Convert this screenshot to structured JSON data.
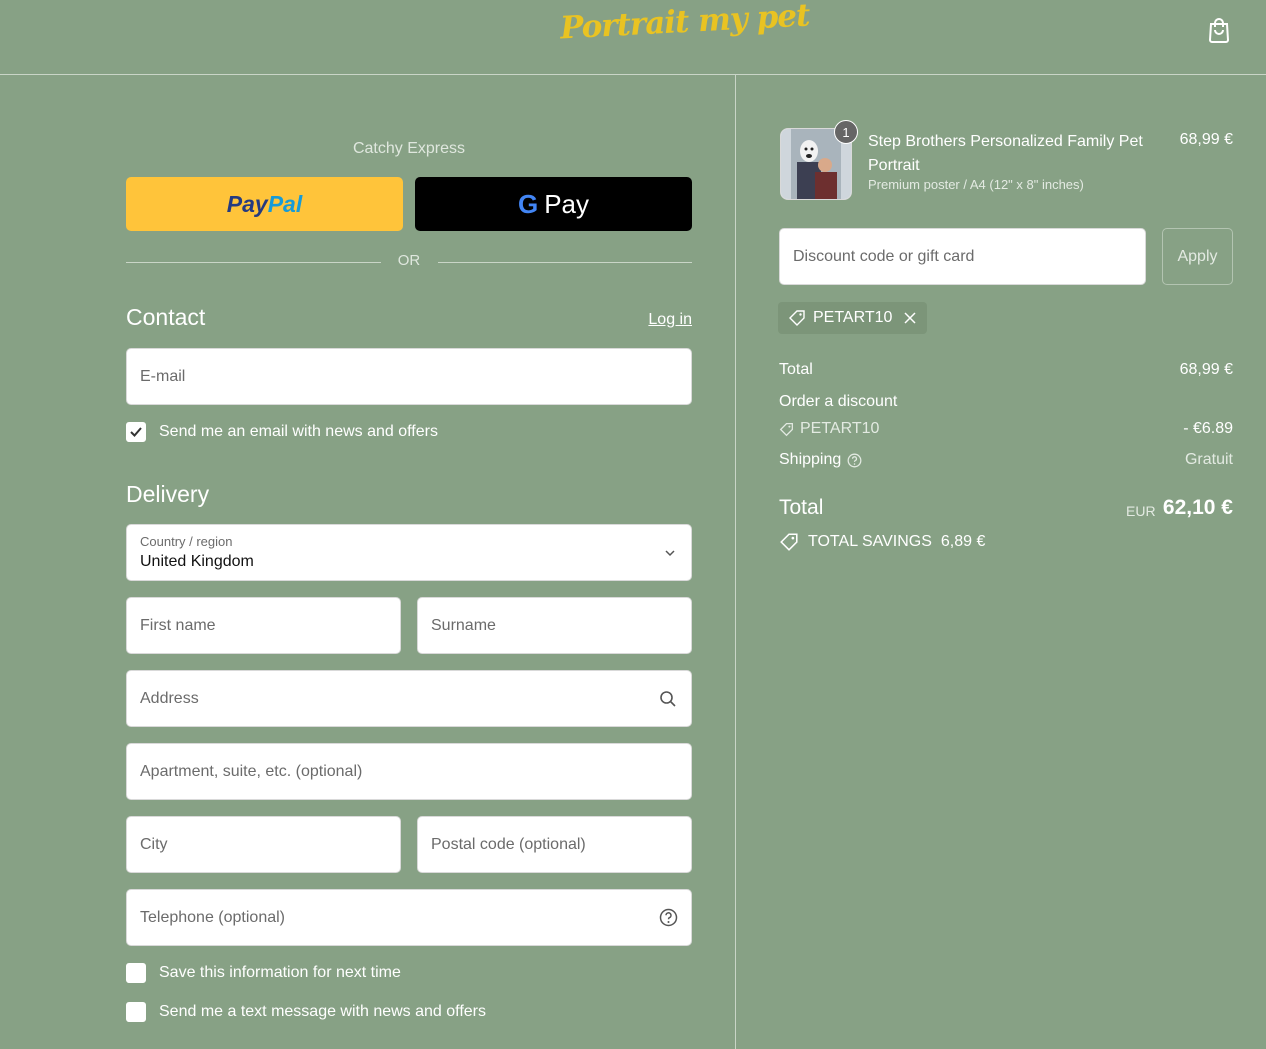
{
  "header": {
    "logo_text": "Portrait my pet",
    "cart_icon": "shopping-bag-icon"
  },
  "express": {
    "title": "Catchy Express",
    "paypal_pay": "Pay",
    "paypal_pal": "Pal",
    "gpay_g": "G",
    "gpay_label": "Pay",
    "or_label": "OR"
  },
  "contact": {
    "title": "Contact",
    "login_label": "Log in",
    "email_placeholder": "E-mail",
    "newsletter_label": "Send me an email with news and offers",
    "newsletter_checked": true
  },
  "delivery": {
    "title": "Delivery",
    "country_label": "Country / region",
    "country_value": "United Kingdom",
    "first_name_placeholder": "First name",
    "surname_placeholder": "Surname",
    "address_placeholder": "Address",
    "apartment_placeholder": "Apartment, suite, etc. (optional)",
    "city_placeholder": "City",
    "postal_placeholder": "Postal code (optional)",
    "telephone_placeholder": "Telephone (optional)",
    "save_info_label": "Save this information for next time",
    "sms_label": "Send me a text message with news and offers"
  },
  "order": {
    "quantity": "1",
    "product_name": "Step Brothers Personalized Family Pet Portrait",
    "product_variant": "Premium poster / A4 (12\" x 8\" inches)",
    "product_price": "68,99 €",
    "discount_placeholder": "Discount code or gift card",
    "apply_label": "Apply",
    "applied_code": "PETART10",
    "summary": {
      "total_label": "Total",
      "total_value": "68,99 €",
      "order_discount_label": "Order a discount",
      "discount_code": "PETART10",
      "discount_value": "- €6.89",
      "shipping_label": "Shipping",
      "shipping_value": "Gratuit"
    },
    "grand_total_label": "Total",
    "currency": "EUR",
    "grand_total_value": "62,10 €",
    "savings_label": "TOTAL SAVINGS",
    "savings_value": "6,89 €"
  },
  "colors": {
    "background": "#87a185",
    "logo": "#e9c322",
    "paypal": "#ffc43a",
    "gpay": "#000000"
  }
}
